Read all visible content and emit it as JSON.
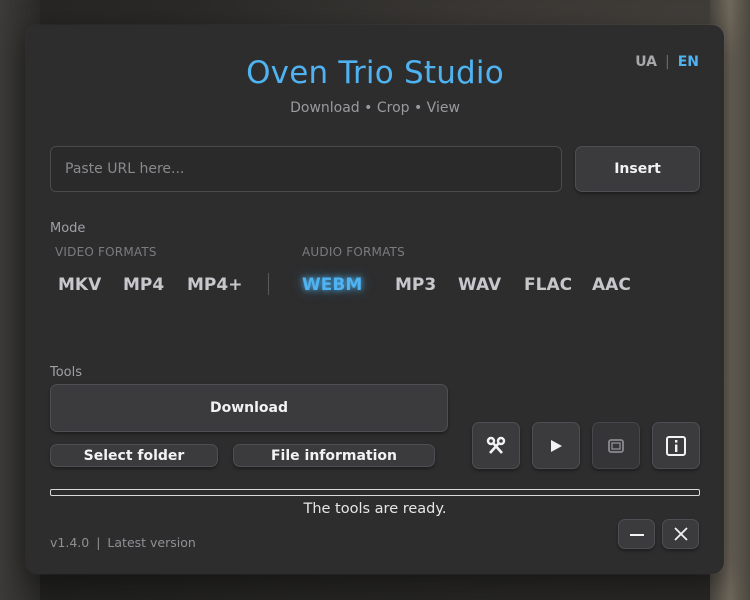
{
  "app": {
    "title": "Oven Trio Studio",
    "subtitle": "Download • Crop • View"
  },
  "lang": {
    "ua": "UA",
    "separator": "|",
    "en": "EN",
    "active": "EN"
  },
  "url": {
    "placeholder": "Paste URL here...",
    "value": ""
  },
  "insert_label": "Insert",
  "mode": {
    "label": "Mode",
    "video_label": "VIDEO FORMATS",
    "audio_label": "AUDIO FORMATS",
    "video_formats": [
      "MKV",
      "MP4",
      "MP4+"
    ],
    "audio_formats": [
      "WEBM",
      "MP3",
      "WAV",
      "FLAC",
      "AAC"
    ],
    "selected": "WEBM"
  },
  "tools": {
    "label": "Tools",
    "download_label": "Download",
    "select_folder_label": "Select folder",
    "file_info_label": "File information",
    "icons": [
      "scissors-icon",
      "play-icon",
      "crop-icon",
      "info-icon"
    ]
  },
  "progress": {
    "value": 0
  },
  "status": "The tools are ready.",
  "footer": {
    "version": "v1.4.0",
    "separator": "|",
    "version_status": "Latest version"
  },
  "colors": {
    "accent": "#4fb3f2",
    "panel": "#2d2d2e",
    "button": "#3b3b3d"
  }
}
